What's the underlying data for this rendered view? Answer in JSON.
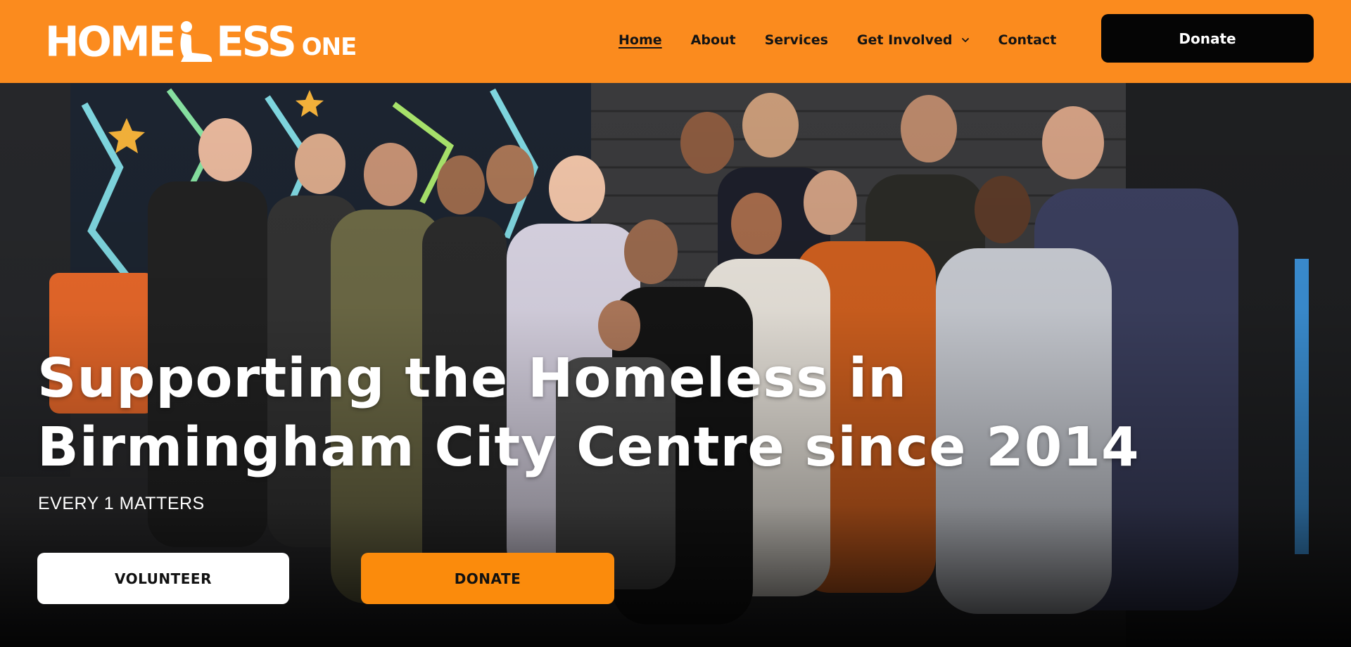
{
  "header": {
    "logo": {
      "word_left": "HOME",
      "word_right": "ESS",
      "suffix": "ONE"
    },
    "nav": [
      {
        "label": "Home",
        "active": true
      },
      {
        "label": "About"
      },
      {
        "label": "Services"
      },
      {
        "label": "Get Involved",
        "has_dropdown": true
      },
      {
        "label": "Contact"
      }
    ],
    "donate_label": "Donate"
  },
  "hero": {
    "title_line1": "Supporting the Homeless in",
    "title_line2": "Birmingham City Centre since 2014",
    "tagline": "EVERY 1 MATTERS",
    "volunteer_label": "VOLUNTEER",
    "donate_label": "DONATE"
  },
  "colors": {
    "brand_orange": "#fb8b1e",
    "button_orange": "#fb8b0c",
    "header_button": "#050505",
    "text_light": "#ffffff"
  },
  "icons": {
    "logo_figure": "person-silhouette-icon",
    "dropdown": "chevron-down-icon"
  }
}
